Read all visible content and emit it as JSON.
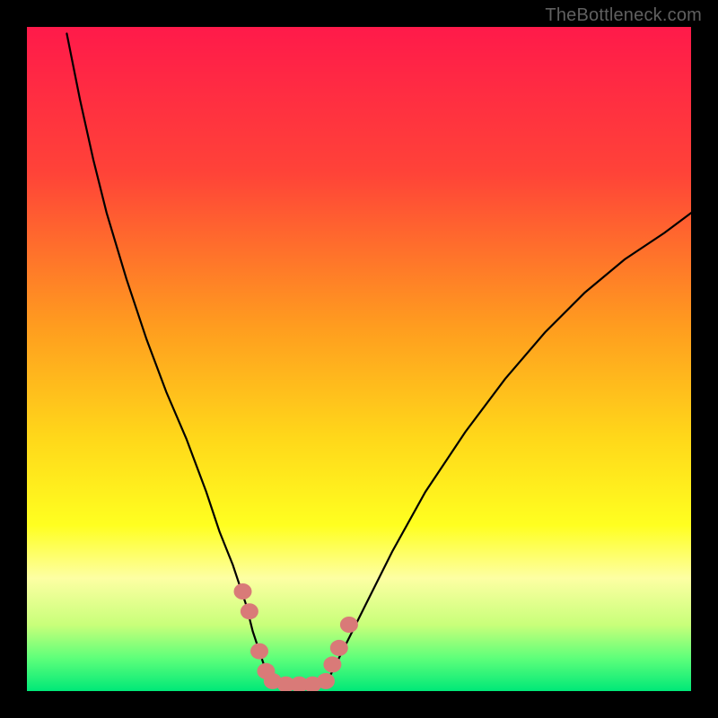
{
  "watermark": "TheBottleneck.com",
  "chart_data": {
    "type": "line",
    "title": "",
    "xlabel": "",
    "ylabel": "",
    "xlim": [
      0,
      100
    ],
    "ylim": [
      0,
      100
    ],
    "series": [
      {
        "name": "left-curve",
        "x": [
          6,
          8,
          10,
          12,
          15,
          18,
          21,
          24,
          27,
          29,
          31,
          33,
          34,
          35,
          36,
          37
        ],
        "y": [
          99,
          89,
          80,
          72,
          62,
          53,
          45,
          38,
          30,
          24,
          19,
          13,
          9,
          6,
          3,
          1
        ]
      },
      {
        "name": "right-curve",
        "x": [
          45,
          46,
          48,
          51,
          55,
          60,
          66,
          72,
          78,
          84,
          90,
          96,
          100
        ],
        "y": [
          1,
          3,
          7,
          13,
          21,
          30,
          39,
          47,
          54,
          60,
          65,
          69,
          72
        ]
      }
    ],
    "markers": {
      "left_cluster": [
        {
          "x": 32.5,
          "y": 15
        },
        {
          "x": 33.5,
          "y": 12
        },
        {
          "x": 35.0,
          "y": 6
        },
        {
          "x": 36.0,
          "y": 3
        },
        {
          "x": 37.0,
          "y": 1.5
        },
        {
          "x": 39.0,
          "y": 1
        },
        {
          "x": 41.0,
          "y": 1
        },
        {
          "x": 43.0,
          "y": 1
        }
      ],
      "right_cluster": [
        {
          "x": 45.0,
          "y": 1.5
        },
        {
          "x": 46.0,
          "y": 4
        },
        {
          "x": 47.0,
          "y": 6.5
        },
        {
          "x": 48.5,
          "y": 10
        }
      ]
    },
    "background_gradient": {
      "stops": [
        {
          "offset": 0,
          "color": "#ff1a4a"
        },
        {
          "offset": 0.22,
          "color": "#ff4338"
        },
        {
          "offset": 0.45,
          "color": "#ff9c1f"
        },
        {
          "offset": 0.62,
          "color": "#ffd81a"
        },
        {
          "offset": 0.75,
          "color": "#ffff20"
        },
        {
          "offset": 0.83,
          "color": "#fdffa3"
        },
        {
          "offset": 0.9,
          "color": "#c9ff7a"
        },
        {
          "offset": 0.95,
          "color": "#5fff7a"
        },
        {
          "offset": 1.0,
          "color": "#00e878"
        }
      ]
    },
    "marker_color": "#d97a78",
    "curve_color": "#000000"
  }
}
